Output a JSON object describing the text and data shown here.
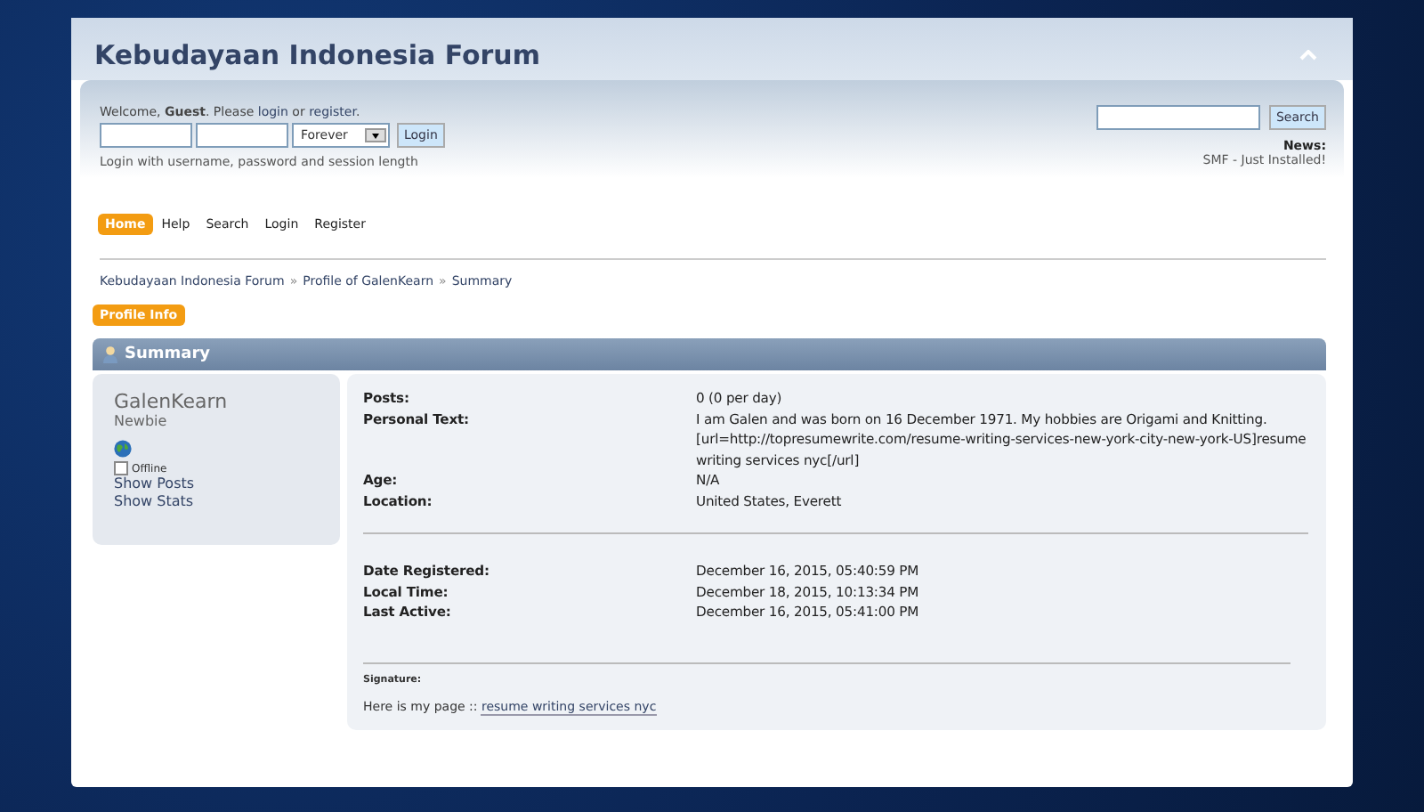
{
  "forum_title": "Kebudayaan Indonesia Forum",
  "user_panel": {
    "welcome_before": "Welcome, **Guest**. Please ",
    "login_link": "login",
    "welcome_middle": " or ",
    "register_link": "register",
    "welcome_after": ".",
    "session_length": "Forever",
    "login_button": "Login",
    "hint": "Login with username, password and session length"
  },
  "search": {
    "button": "Search"
  },
  "news": {
    "title": "News:",
    "text": "SMF - Just Installed!"
  },
  "menu": [
    {
      "label": "Home",
      "selected": true
    },
    {
      "label": "Help",
      "selected": false
    },
    {
      "label": "Search",
      "selected": false
    },
    {
      "label": "Login",
      "selected": false
    },
    {
      "label": "Register",
      "selected": false
    }
  ],
  "breadcrumbs": [
    "Kebudayaan Indonesia Forum",
    "Profile of GalenKearn",
    "Summary"
  ],
  "breadcrumb_separator": "»",
  "profile_button": "Profile Info",
  "section_title": "Summary",
  "profile": {
    "name": "GalenKearn",
    "group": "Newbie",
    "online": false,
    "status": "Offline",
    "links": [
      "Show Posts",
      "Show Stats"
    ]
  },
  "details": [
    {
      "label": "Posts:",
      "value": "0 (0 per day)"
    },
    {
      "label": "Personal Text:",
      "value": "I am Galen and was born on 16 December 1971. My hobbies are Origami and Knitting. [url=http://topresumewrite.com/resume-writing-services-new-york-city-new-york-US]resume writing services nyc[/url]"
    },
    {
      "label": "Age:",
      "value": "N/A"
    },
    {
      "label": "Location:",
      "value": "United States, Everett"
    }
  ],
  "dates": [
    {
      "label": "Date Registered:",
      "value": "December 16, 2015, 05:40:59 PM"
    },
    {
      "label": "Local Time:",
      "value": "December 18, 2015, 10:13:34 PM"
    },
    {
      "label": "Last Active:",
      "value": "December 16, 2015, 05:41:00 PM"
    }
  ],
  "signature": {
    "title": "Signature:",
    "text": "Here is my page :: ",
    "link": "resume writing services nyc"
  }
}
